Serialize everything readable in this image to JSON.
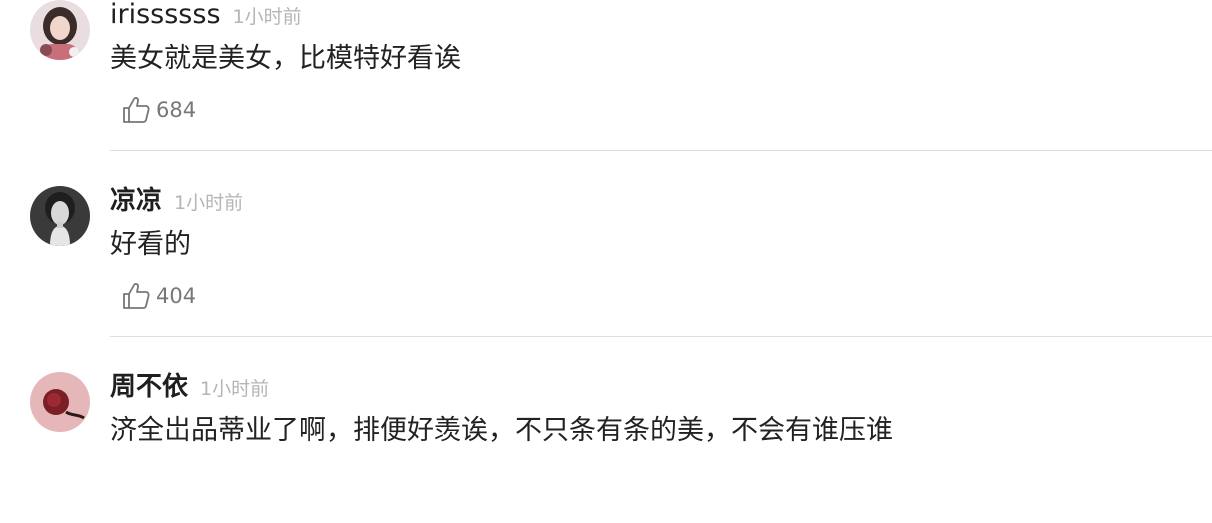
{
  "comments": [
    {
      "username": "irissssss",
      "time": "1小时前",
      "text": "美女就是美女，比模特好看诶",
      "likes": "684",
      "avatar_icon": "avatar-woman-icon"
    },
    {
      "username": "凉凉",
      "time": "1小时前",
      "text": "好看的",
      "likes": "404",
      "avatar_icon": "avatar-portrait-bw-icon"
    },
    {
      "username": "周不依",
      "time": "1小时前",
      "text": "济全岀品蒂业了啊，排便好羡诶，不只条有条的美，不会有谁压谁",
      "likes": "",
      "avatar_icon": "avatar-rose-icon"
    }
  ],
  "colors": {
    "username": "#1f1f1f",
    "time": "#b5b5b5",
    "text": "#222222",
    "like_count": "#777777",
    "divider": "#dedede"
  }
}
